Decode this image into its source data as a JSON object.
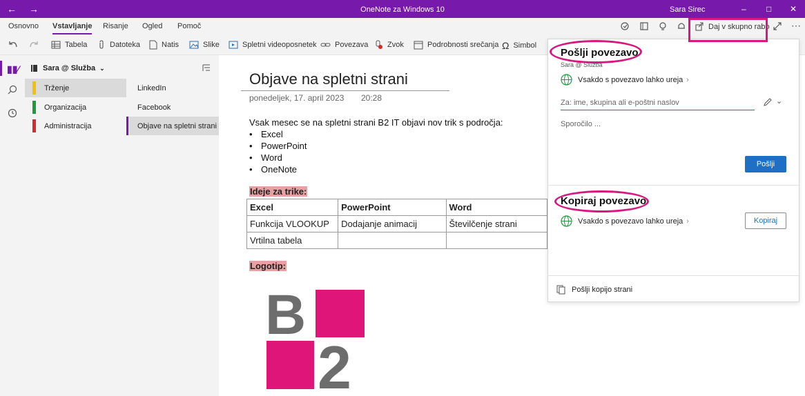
{
  "window": {
    "title": "OneNote za Windows 10",
    "user": "Sara Sirec"
  },
  "menu": {
    "tabs": [
      "Osnovno",
      "Vstavljanje",
      "Risanje",
      "Ogled",
      "Pomoč"
    ],
    "active_tab": "Vstavljanje",
    "share_label": "Daj v skupno rabo"
  },
  "ribbon": {
    "items": [
      "Tabela",
      "Datoteka",
      "Natis",
      "Slike",
      "Spletni videoposnetek",
      "Povezava",
      "Zvok",
      "Podrobnosti srečanja",
      "Simbol"
    ]
  },
  "notebook": {
    "name": "Sara @ Služba",
    "sections": [
      {
        "label": "Trženje",
        "color": "#f2c200"
      },
      {
        "label": "Organizacija",
        "color": "#1e9c3a"
      },
      {
        "label": "Administracija",
        "color": "#d62b2b"
      }
    ],
    "pages": [
      "LinkedIn",
      "Facebook",
      "Objave na spletni strani"
    ]
  },
  "note": {
    "title": "Objave na spletni strani",
    "date": "ponedeljek, 17. april 2023",
    "time": "20:28",
    "intro": "Vsak mesec se na spletni strani B2 IT objavi nov trik s področja:",
    "bullets": [
      "Excel",
      "PowerPoint",
      "Word",
      "OneNote"
    ],
    "ideas_heading": "Ideje za trike:",
    "table_header": [
      "Excel",
      "PowerPoint",
      "Word"
    ],
    "table_rows": [
      [
        "Funkcija VLOOKUP",
        "Dodajanje animacij",
        "Številčenje strani"
      ],
      [
        "Vrtilna tabela",
        "",
        ""
      ]
    ],
    "logo_heading": "Logotip:",
    "logo_text": "B2"
  },
  "share_panel": {
    "send_title": "Pošlji povezavo",
    "account": "Sara @ Služba",
    "permission": "Vsakdo s povezavo lahko ureja",
    "to_placeholder": "Za: ime, skupina ali e-poštni naslov",
    "message_placeholder": "Sporočilo ...",
    "send_button": "Pošlji",
    "copy_title": "Kopiraj povezavo",
    "copy_permission": "Vsakdo s povezavo lahko ureja",
    "copy_button": "Kopiraj",
    "send_copy": "Pošlji kopijo strani"
  },
  "colors": {
    "accent": "#7719aa",
    "highlight": "#d6197f",
    "primary_button": "#1f6fc5",
    "logo_pink": "#e0157a",
    "logo_gray": "#6d6d6d"
  }
}
